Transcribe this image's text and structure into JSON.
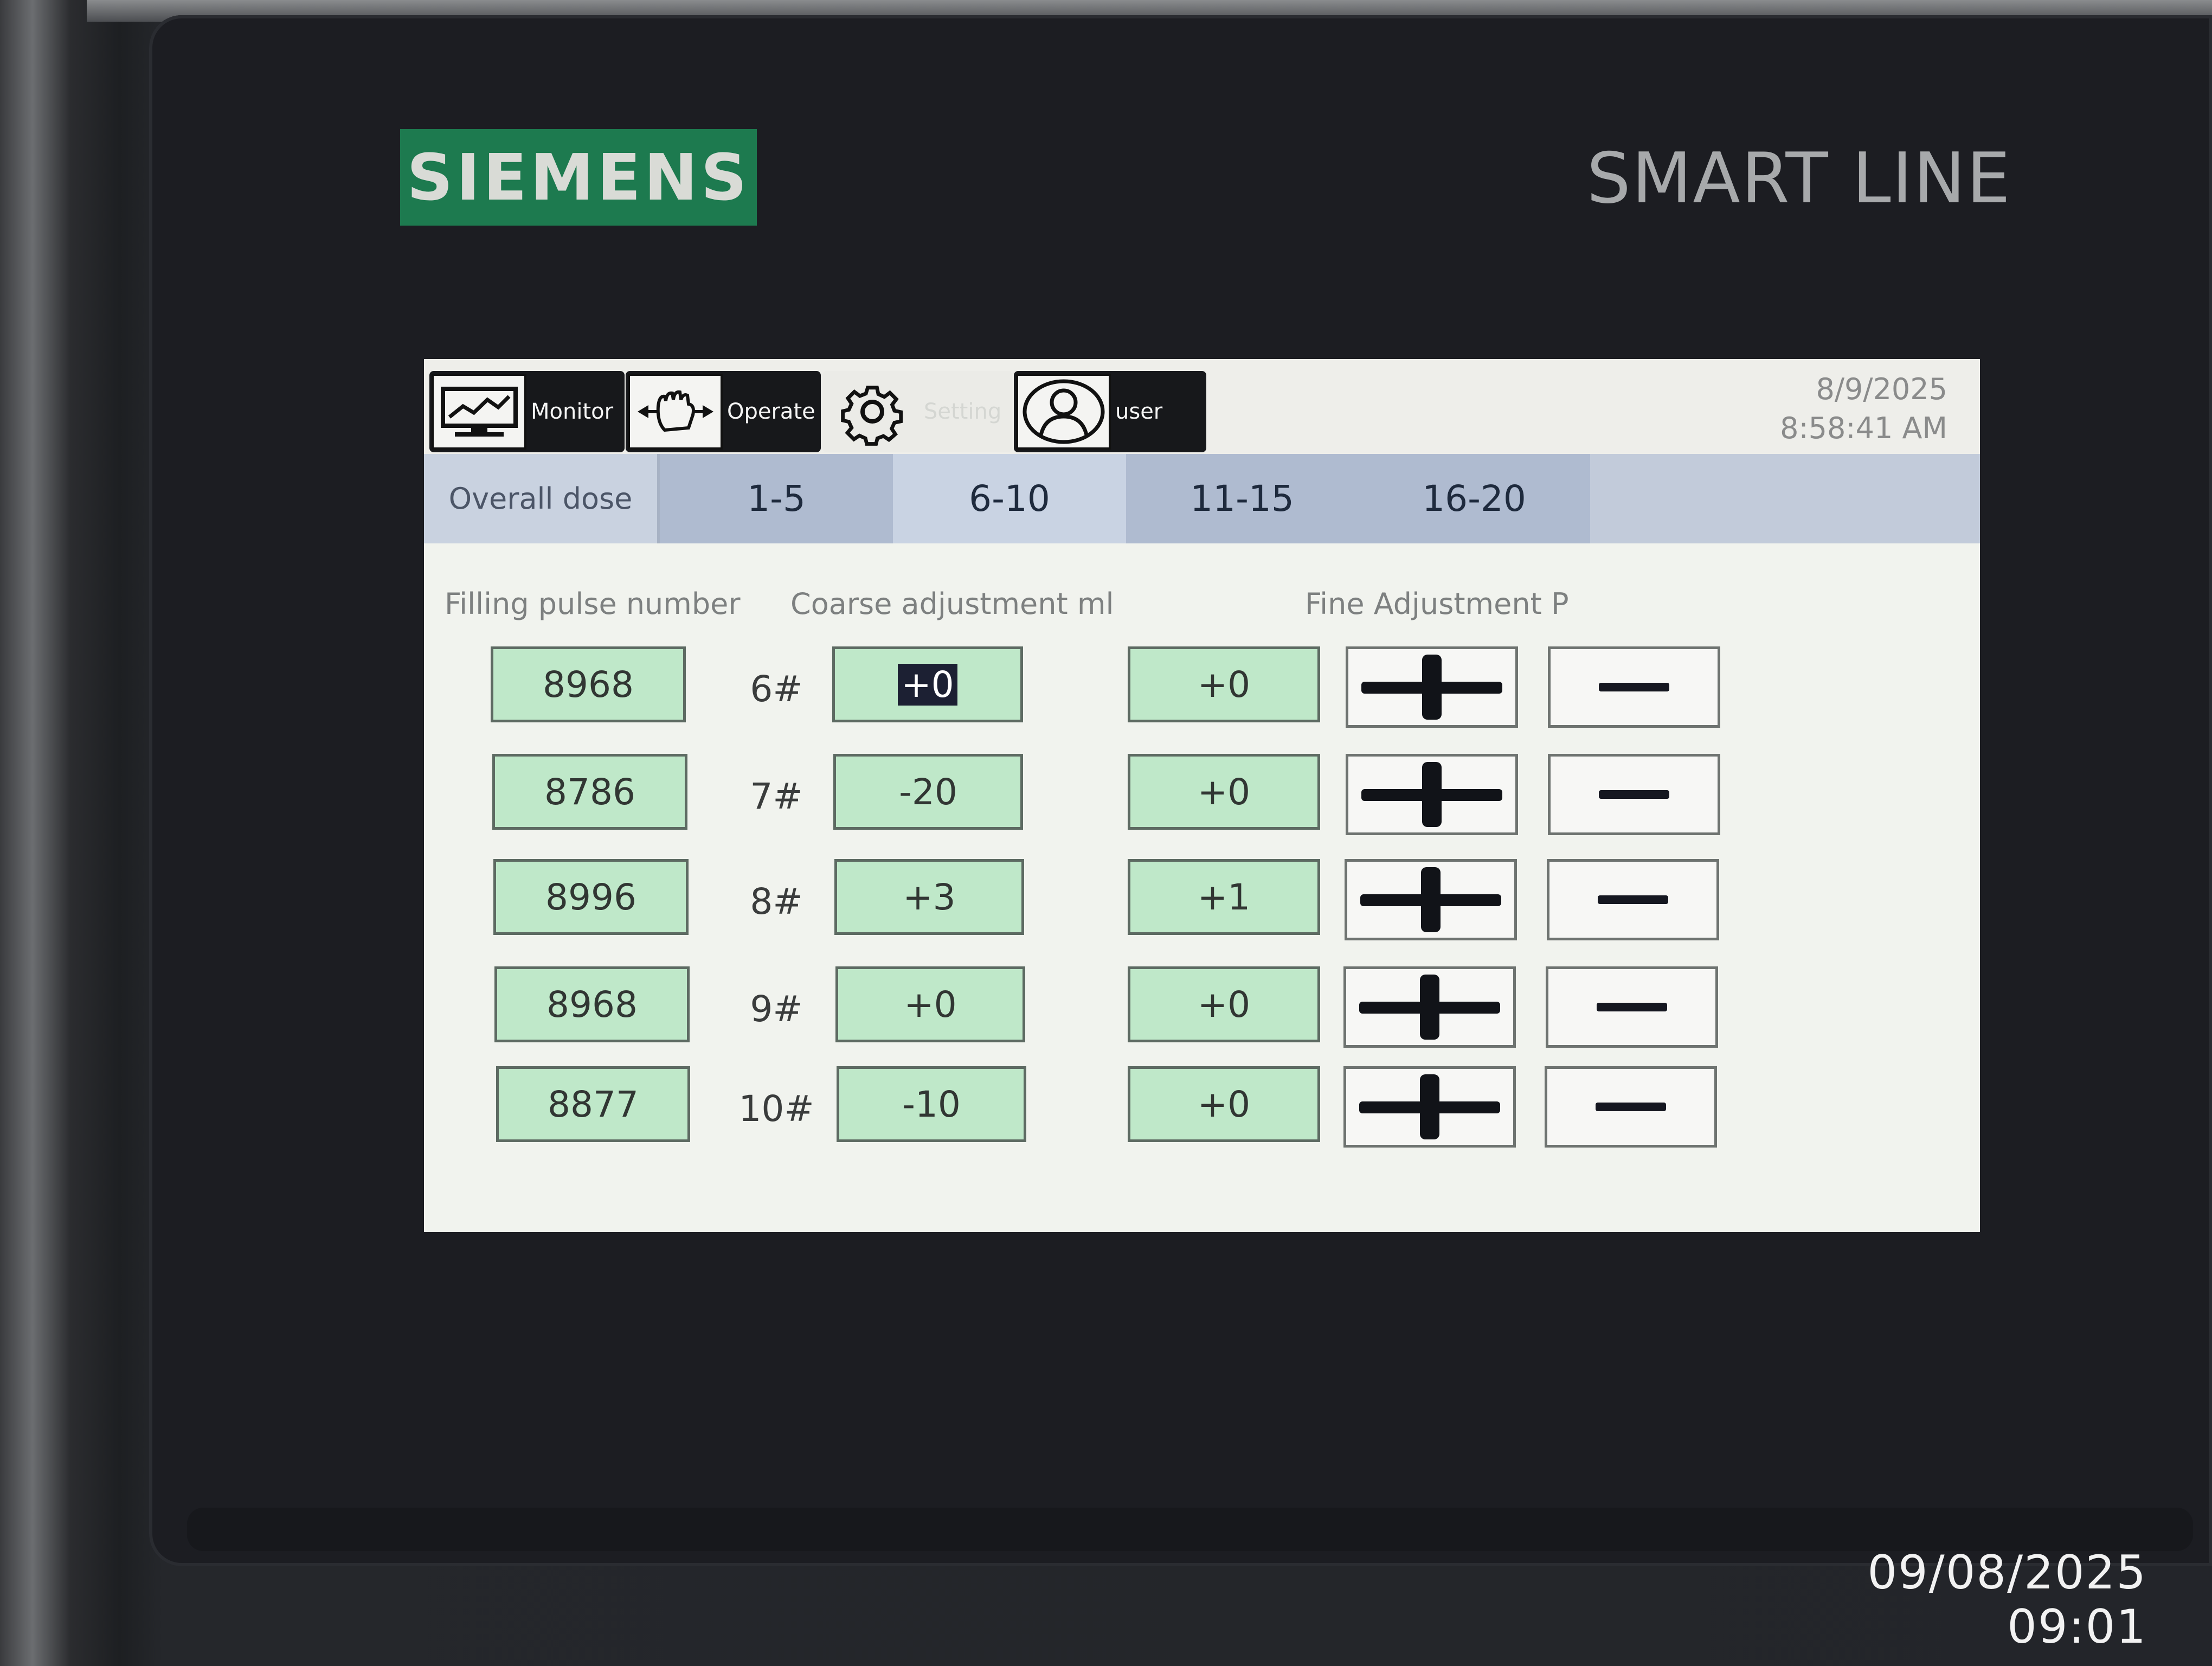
{
  "device": {
    "brand": "SIEMENS",
    "model_line": "SMART LINE"
  },
  "photo_timestamp": "09/08/2025 09:01",
  "nav": {
    "monitor_label": "Monitor",
    "operate_label": "Operate",
    "setting_label": "Setting",
    "user_label": "user"
  },
  "clock": {
    "date": "8/9/2025",
    "time": "8:58:41 AM"
  },
  "tabs": {
    "overall": "Overall dose",
    "t1": "1-5",
    "t2": "6-10",
    "t3": "11-15",
    "t4": "16-20",
    "active_tab": "6-10"
  },
  "columns": {
    "pulse": "Filling pulse number",
    "coarse": "Coarse adjustment ml",
    "fine": "Fine Adjustment P"
  },
  "rows": [
    {
      "label": "6#",
      "pulse": "8968",
      "coarse": "+0",
      "fine": "+0"
    },
    {
      "label": "7#",
      "pulse": "8786",
      "coarse": "-20",
      "fine": "+0"
    },
    {
      "label": "8#",
      "pulse": "8996",
      "coarse": "+3",
      "fine": "+1"
    },
    {
      "label": "9#",
      "pulse": "8968",
      "coarse": "+0",
      "fine": "+0"
    },
    {
      "label": "10#",
      "pulse": "8877",
      "coarse": "-10",
      "fine": "+0"
    }
  ],
  "colors": {
    "field_green": "#bfe8c9",
    "tab_active": "#c9d3e3",
    "tab_inactive": "#afbbd0",
    "brand_green": "#1d7a4f"
  }
}
